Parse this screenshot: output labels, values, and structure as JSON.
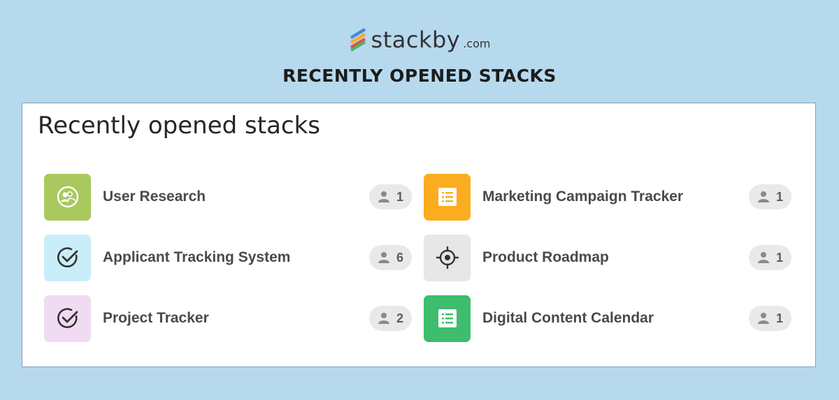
{
  "brand": {
    "name": "stackby",
    "tld": ".com",
    "logo_icon": "stackby-logo-icon"
  },
  "headline": "RECENTLY OPENED STACKS",
  "panel": {
    "title": "Recently opened stacks",
    "stacks": [
      {
        "name": "User Research",
        "members": "1",
        "icon": "users-icon",
        "tile_color": "#a9c95e"
      },
      {
        "name": "Applicant Tracking System",
        "members": "6",
        "icon": "checkmark-circle-icon",
        "tile_color": "#c9eefa"
      },
      {
        "name": "Project Tracker",
        "members": "2",
        "icon": "checkmark-circle-icon",
        "tile_color": "#f1dbf3"
      },
      {
        "name": "Marketing Campaign Tracker",
        "members": "1",
        "icon": "list-icon",
        "tile_color": "#fbac1f"
      },
      {
        "name": "Product Roadmap",
        "members": "1",
        "icon": "target-icon",
        "tile_color": "#e7e7e7"
      },
      {
        "name": "Digital Content Calendar",
        "members": "1",
        "icon": "list-icon",
        "tile_color": "#3dbd6d"
      }
    ]
  }
}
